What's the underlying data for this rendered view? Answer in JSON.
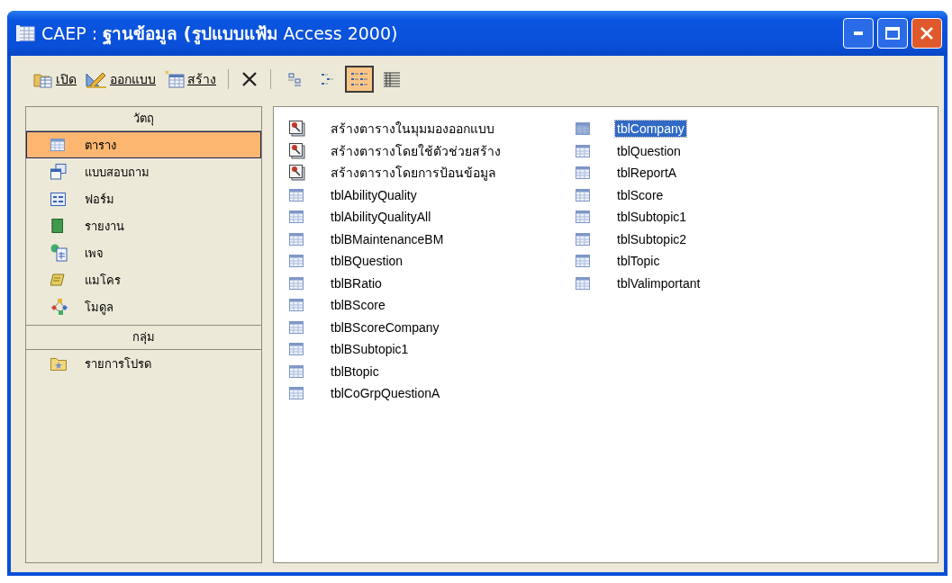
{
  "window": {
    "title_app": "CAEP :",
    "title_bold": "ฐานข้อมูล (รูปแบบแฟ้ม",
    "title_rest": "Access 2000)"
  },
  "toolbar": {
    "commands": [
      {
        "kind": "open",
        "label": "เปิด"
      },
      {
        "kind": "design",
        "label": "ออกแบบ"
      },
      {
        "kind": "new",
        "label": "สร้าง"
      }
    ],
    "views": [
      {
        "kind": "large",
        "selected": false
      },
      {
        "kind": "small",
        "selected": false
      },
      {
        "kind": "list",
        "selected": true
      },
      {
        "kind": "details",
        "selected": false
      }
    ]
  },
  "sidebar": {
    "groups": [
      {
        "header": "วัตถุ",
        "items": [
          {
            "kind": "table",
            "label": "ตาราง",
            "selected": true
          },
          {
            "kind": "query",
            "label": "แบบสอบถาม",
            "selected": false
          },
          {
            "kind": "form",
            "label": "ฟอร์ม",
            "selected": false
          },
          {
            "kind": "report",
            "label": "รายงาน",
            "selected": false
          },
          {
            "kind": "page",
            "label": "เพจ",
            "selected": false
          },
          {
            "kind": "macro",
            "label": "แมโคร",
            "selected": false
          },
          {
            "kind": "module",
            "label": "โมดูล",
            "selected": false
          }
        ]
      },
      {
        "header": "กลุ่ม",
        "items": [
          {
            "kind": "favorites",
            "label": "รายการโปรด",
            "selected": false
          }
        ]
      }
    ]
  },
  "list": {
    "items": [
      {
        "kind": "wizard",
        "label": "สร้างตารางในมุมมองออกแบบ",
        "selected": false
      },
      {
        "kind": "wizard",
        "label": "สร้างตารางโดยใช้ตัวช่วยสร้าง",
        "selected": false
      },
      {
        "kind": "wizard",
        "label": "สร้างตารางโดยการป้อนข้อมูล",
        "selected": false
      },
      {
        "kind": "table",
        "label": "tblAbilityQuality",
        "selected": false
      },
      {
        "kind": "table",
        "label": "tblAbilityQualityAll",
        "selected": false
      },
      {
        "kind": "table",
        "label": "tblBMaintenanceBM",
        "selected": false
      },
      {
        "kind": "table",
        "label": "tblBQuestion",
        "selected": false
      },
      {
        "kind": "table",
        "label": "tblBRatio",
        "selected": false
      },
      {
        "kind": "table",
        "label": "tblBScore",
        "selected": false
      },
      {
        "kind": "table",
        "label": "tblBScoreCompany",
        "selected": false
      },
      {
        "kind": "table",
        "label": "tblBSubtopic1",
        "selected": false
      },
      {
        "kind": "table",
        "label": "tblBtopic",
        "selected": false
      },
      {
        "kind": "table",
        "label": "tblCoGrpQuestionA",
        "selected": false
      },
      {
        "kind": "table",
        "label": "tblCompany",
        "selected": true
      },
      {
        "kind": "table",
        "label": "tblQuestion",
        "selected": false
      },
      {
        "kind": "table",
        "label": "tblReportA",
        "selected": false
      },
      {
        "kind": "table",
        "label": "tblScore",
        "selected": false
      },
      {
        "kind": "table",
        "label": "tblSubtopic1",
        "selected": false
      },
      {
        "kind": "table",
        "label": "tblSubtopic2",
        "selected": false
      },
      {
        "kind": "table",
        "label": "tblTopic",
        "selected": false
      },
      {
        "kind": "table",
        "label": "tblValimportant",
        "selected": false
      }
    ]
  }
}
